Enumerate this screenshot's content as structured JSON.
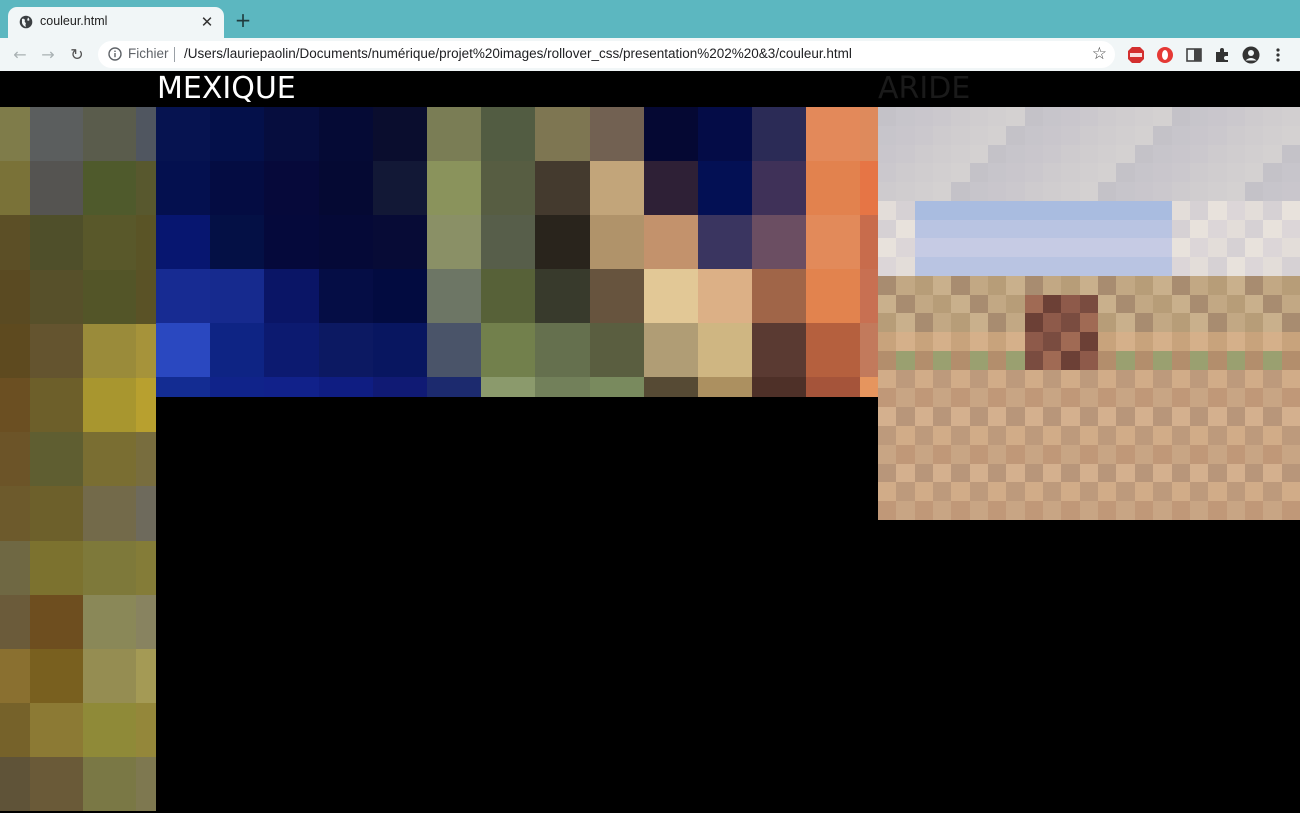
{
  "browser": {
    "tab_title": "couleur.html",
    "new_tab_icon": "plus-icon",
    "address_scheme": "Fichier",
    "address_url": "/Users/lauriepaolin/Documents/numérique/projet%20images/rollover_css/presentation%202%20&3/couleur.html",
    "extensions": [
      "adblock-icon",
      "opera-red-icon",
      "reader-icon",
      "puzzle-icon",
      "profile-icon",
      "menu-icon"
    ]
  },
  "page": {
    "label_left": "MEXIQUE",
    "label_right": "ARIDE",
    "label_left_color": "#ffffff",
    "label_right_color": "#1a1a1a"
  },
  "colors": {
    "tabbar": "#5cb7c0",
    "toolbar": "#f1f6f7",
    "page_background": "#000000"
  }
}
